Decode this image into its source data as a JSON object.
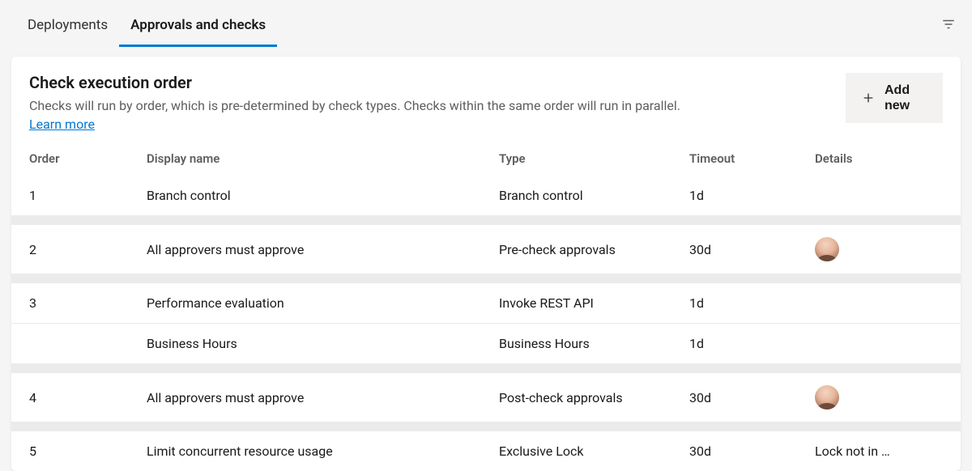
{
  "tabs": [
    {
      "label": "Deployments",
      "active": false
    },
    {
      "label": "Approvals and checks",
      "active": true
    }
  ],
  "header": {
    "title": "Check execution order",
    "description": "Checks will run by order, which is pre-determined by check types. Checks within the same order will run in parallel.",
    "learn_more": "Learn more",
    "add_button": "Add new"
  },
  "columns": {
    "order": "Order",
    "name": "Display name",
    "type": "Type",
    "timeout": "Timeout",
    "details": "Details"
  },
  "groups": [
    {
      "rows": [
        {
          "order": "1",
          "name": "Branch control",
          "type": "Branch control",
          "timeout": "1d",
          "details": "",
          "avatar": false
        }
      ]
    },
    {
      "rows": [
        {
          "order": "2",
          "name": "All approvers must approve",
          "type": "Pre-check approvals",
          "timeout": "30d",
          "details": "",
          "avatar": true
        }
      ]
    },
    {
      "rows": [
        {
          "order": "3",
          "name": "Performance evaluation",
          "type": "Invoke REST API",
          "timeout": "1d",
          "details": "",
          "avatar": false
        },
        {
          "order": "",
          "name": "Business Hours",
          "type": "Business Hours",
          "timeout": "1d",
          "details": "",
          "avatar": false
        }
      ]
    },
    {
      "rows": [
        {
          "order": "4",
          "name": "All approvers must approve",
          "type": "Post-check approvals",
          "timeout": "30d",
          "details": "",
          "avatar": true
        }
      ]
    },
    {
      "rows": [
        {
          "order": "5",
          "name": "Limit concurrent resource usage",
          "type": "Exclusive Lock",
          "timeout": "30d",
          "details": "Lock not in …",
          "avatar": false
        }
      ]
    }
  ]
}
